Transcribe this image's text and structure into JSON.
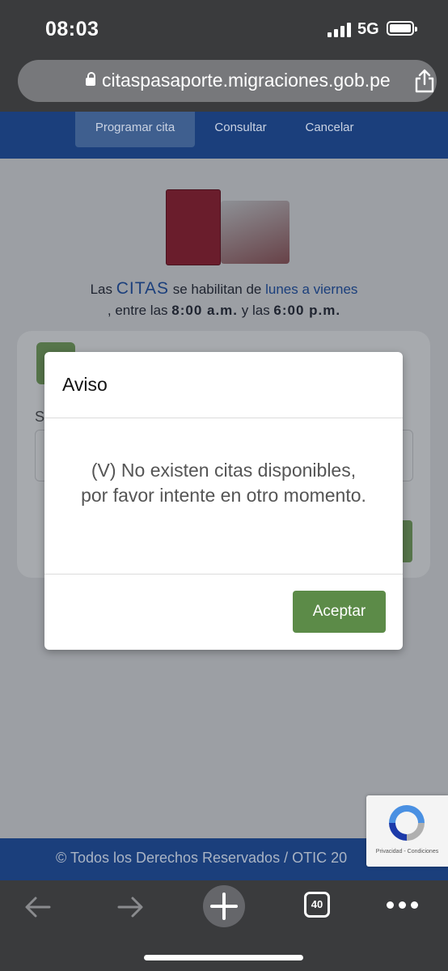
{
  "status_bar": {
    "time": "08:03",
    "network": "5G"
  },
  "browser": {
    "url": "citaspasaporte.migraciones.gob.pe",
    "tab_count": "40"
  },
  "nav": {
    "items": [
      {
        "label": "Programar cita",
        "active": true
      },
      {
        "label": "Consultar",
        "active": false
      },
      {
        "label": "Cancelar",
        "active": false
      }
    ]
  },
  "intro": {
    "part1": "Las ",
    "citas": "CITAS",
    "part2": " se habilitan de ",
    "days": "lunes a viernes",
    "part3": ", entre las ",
    "start": "8:00 a.m.",
    "part4": " y las ",
    "end": "6:00 p.m."
  },
  "card": {
    "label_partial": "S"
  },
  "modal": {
    "title": "Aviso",
    "message": "(V) No existen citas disponibles, por favor intente en otro momento.",
    "accept_label": "Aceptar"
  },
  "footer": {
    "text": "© Todos los Derechos Reservados / OTIC 20"
  },
  "recaptcha": {
    "links": "Privacidad - Condiciones"
  },
  "colors": {
    "nav_blue": "#1b3f7c",
    "accept_green": "#5c8b48"
  }
}
